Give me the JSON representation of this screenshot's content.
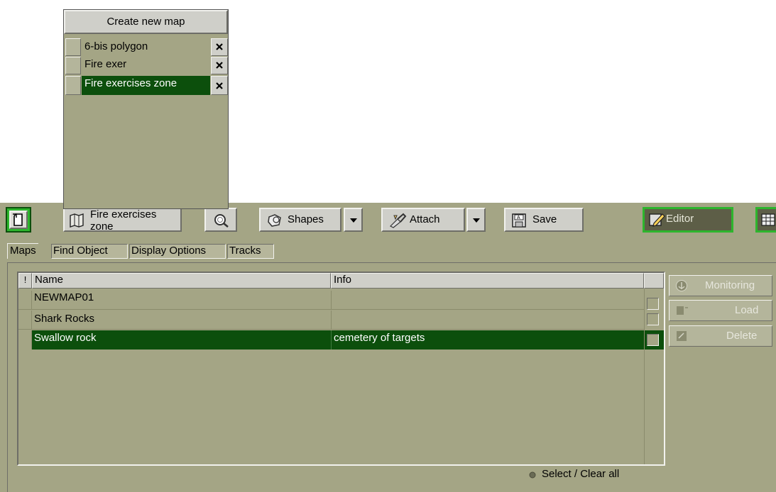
{
  "dropdown": {
    "create_label": "Create new map",
    "items": [
      {
        "label": "6-bis polygon",
        "selected": false
      },
      {
        "label": "Fire exer",
        "selected": false
      },
      {
        "label": "Fire exercises zone",
        "selected": true
      }
    ]
  },
  "toolbar": {
    "map_button_label": "Fire exercises zone",
    "shapes_label": "Shapes",
    "attach_label": "Attach",
    "save_label": "Save",
    "editor_label": "Editor"
  },
  "tabs": [
    {
      "label": "Maps",
      "active": true
    },
    {
      "label": "Find Object",
      "active": false
    },
    {
      "label": "Display Options",
      "active": false
    },
    {
      "label": "Tracks",
      "active": false
    }
  ],
  "table": {
    "columns": {
      "flag": "!",
      "name": "Name",
      "info": "Info"
    },
    "rows": [
      {
        "name": "NEWMAP01",
        "info": "",
        "selected": false
      },
      {
        "name": "Shark Rocks",
        "info": "",
        "selected": false
      },
      {
        "name": "Swallow rock",
        "info": "cemetery of targets",
        "selected": true
      }
    ]
  },
  "side_buttons": {
    "monitoring": "Monitoring",
    "load": "Load",
    "delete": "Delete"
  },
  "footer": {
    "select_clear_all": "Select / Clear all"
  },
  "colors": {
    "olive_panel": "#a4a585",
    "selection_green": "#0c4f0c",
    "active_green": "#2db52d",
    "button_gray": "#cfcfc9"
  }
}
